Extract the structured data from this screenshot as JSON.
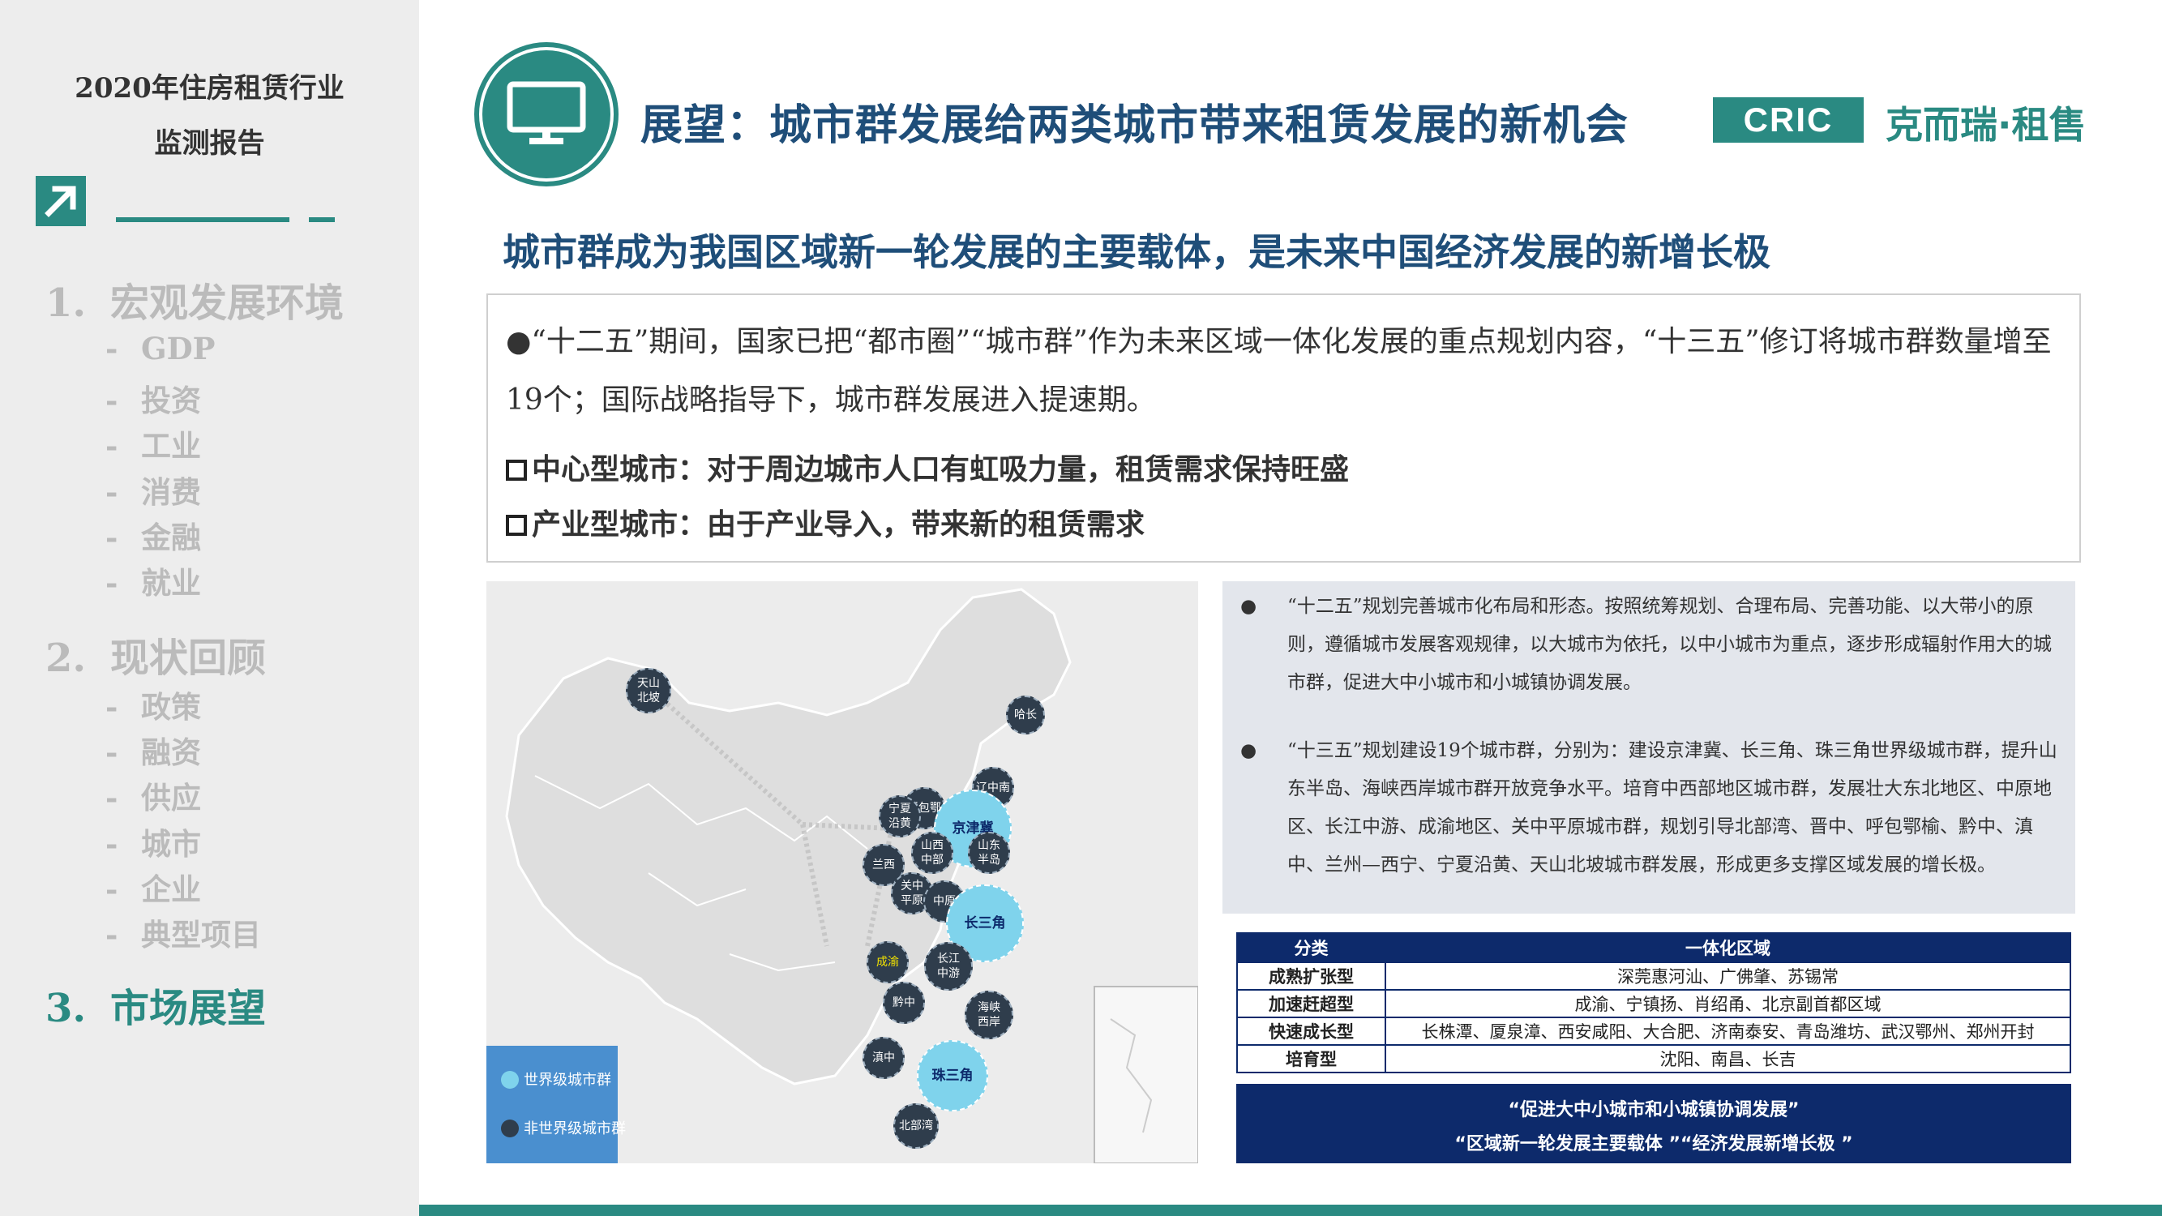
{
  "sidebar": {
    "report_title_line1": "2020年住房租赁行业",
    "report_title_line2": "监测报告",
    "sections": [
      {
        "num": "1.",
        "title": "宏观发展环境",
        "subs": [
          "GDP",
          "投资",
          "工业",
          "消费",
          "金融",
          "就业"
        ]
      },
      {
        "num": "2.",
        "title": "现状回顾",
        "subs": [
          "政策",
          "融资",
          "供应",
          "城市",
          "企业",
          "典型项目"
        ]
      },
      {
        "num": "3.",
        "title": "市场展望",
        "subs": []
      }
    ],
    "active_section": 3,
    "dash": "-"
  },
  "header": {
    "title": "展望：城市群发展给两类城市带来租赁发展的新机会",
    "logo_box": "CRIC",
    "brand": "克而瑞·租售"
  },
  "subtitle": "城市群成为我国区域新一轮发展的主要载体，是未来中国经济发展的新增长极",
  "summary": {
    "bullet": "●",
    "text": "“十二五”期间，国家已把“都市圈”“城市群”作为未来区域一体化发展的重点规划内容，“十三五”修订将城市群数量增至19个；国际战略指导下，城市群发展进入提速期。",
    "points": [
      "中心型城市：对于周边城市人口有虹吸力量，租赁需求保持旺盛",
      "产业型城市：由于产业导入，带来新的租赁需求"
    ]
  },
  "map": {
    "city_clusters": [
      {
        "label": "天山\n北坡",
        "type": "non-world"
      },
      {
        "label": "哈长",
        "type": "non-world"
      },
      {
        "label": "辽中南",
        "type": "non-world"
      },
      {
        "label": "呼包鄂",
        "type": "non-world"
      },
      {
        "label": "宁夏\n沿黄",
        "type": "non-world"
      },
      {
        "label": "京津冀",
        "type": "world"
      },
      {
        "label": "山西\n中部",
        "type": "non-world"
      },
      {
        "label": "山东\n半岛",
        "type": "non-world"
      },
      {
        "label": "兰西",
        "type": "non-world"
      },
      {
        "label": "关中\n平原",
        "type": "non-world"
      },
      {
        "label": "中原",
        "type": "non-world"
      },
      {
        "label": "长三角",
        "type": "world"
      },
      {
        "label": "成渝",
        "type": "non-world"
      },
      {
        "label": "长江\n中游",
        "type": "non-world"
      },
      {
        "label": "黔中",
        "type": "non-world"
      },
      {
        "label": "海峡\n西岸",
        "type": "non-world"
      },
      {
        "label": "滇中",
        "type": "non-world"
      },
      {
        "label": "珠三角",
        "type": "world"
      },
      {
        "label": "北部湾",
        "type": "non-world"
      }
    ],
    "legend": {
      "world": "世界级城市群",
      "non_world": "非世界级城市群"
    },
    "colors": {
      "world": "#7fd3ec",
      "non_world": "#2f3d4c",
      "legend_bg": "#4a8fcf"
    }
  },
  "info": {
    "bullet": "●",
    "p1": "“十二五”规划完善城市化布局和形态。按照统筹规划、合理布局、完善功能、以大带小的原则，遵循城市发展客观规律，以大城市为依托，以中小城市为重点，逐步形成辐射作用大的城市群，促进大中小城市和小城镇协调发展。",
    "p2": "“十三五”规划建设19个城市群，分别为：建设京津冀、长三角、珠三角世界级城市群，提升山东半岛、海峡西岸城市群开放竞争水平。培育中西部地区城市群，发展壮大东北地区、中原地区、长江中游、成渝地区、关中平原城市群，规划引导北部湾、晋中、呼包鄂榆、黔中、滇中、兰州—西宁、宁夏沿黄、天山北坡城市群发展，形成更多支撑区域发展的增长极。"
  },
  "table": {
    "headers": [
      "分类",
      "一体化区域"
    ],
    "rows": [
      [
        "成熟扩张型",
        "深莞惠河汕、广佛肇、苏锡常"
      ],
      [
        "加速赶超型",
        "成渝、宁镇扬、肖绍甬、北京副首都区域"
      ],
      [
        "快速成长型",
        "长株潭、厦泉漳、西安咸阳、大合肥、济南泰安、青岛潍坊、武汉鄂州、郑州开封"
      ],
      [
        "培育型",
        "沈阳、南昌、长吉"
      ]
    ]
  },
  "quote": {
    "line1": "“促进大中小城市和小城镇协调发展”",
    "line2": "“区域新一轮发展主要载体 ”“经济发展新增长极 ”"
  },
  "colors": {
    "accent": "#2a8a82",
    "title_blue": "#1f4e79",
    "navy": "#0d2a6b"
  }
}
